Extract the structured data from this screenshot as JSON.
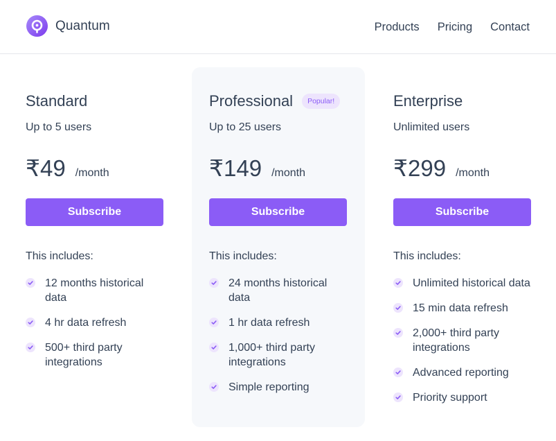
{
  "header": {
    "brand": "Quantum",
    "nav": [
      "Products",
      "Pricing",
      "Contact"
    ]
  },
  "colors": {
    "accent": "#8b5cf6",
    "badge_bg": "#ede4fd",
    "featured_bg": "#f6f8fb",
    "text": "#334155"
  },
  "plans": [
    {
      "name": "Standard",
      "users": "Up to 5 users",
      "price": "₹49",
      "period": "/month",
      "cta": "Subscribe",
      "includes_label": "This includes:",
      "features": [
        "12 months historical data",
        "4 hr data refresh",
        "500+ third party integrations"
      ]
    },
    {
      "name": "Professional",
      "badge": "Popular!",
      "users": "Up to 25 users",
      "price": "₹149",
      "period": "/month",
      "cta": "Subscribe",
      "includes_label": "This includes:",
      "features": [
        "24 months historical data",
        "1 hr data refresh",
        "1,000+ third party integrations",
        "Simple reporting"
      ]
    },
    {
      "name": "Enterprise",
      "users": "Unlimited users",
      "price": "₹299",
      "period": "/month",
      "cta": "Subscribe",
      "includes_label": "This includes:",
      "features": [
        "Unlimited historical data",
        "15 min data refresh",
        "2,000+ third party integrations",
        "Advanced reporting",
        "Priority support"
      ]
    }
  ]
}
